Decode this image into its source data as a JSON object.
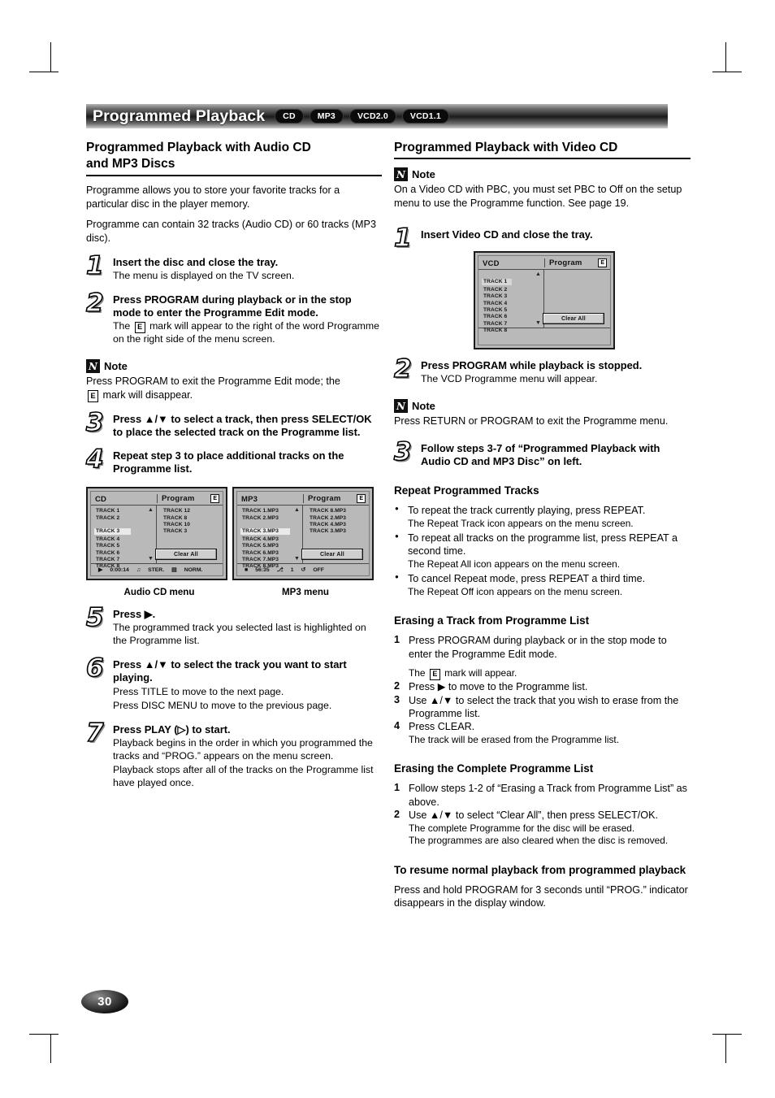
{
  "header": {
    "title": "Programmed Playback",
    "badges": [
      "CD",
      "MP3",
      "VCD2.0",
      "VCD1.1"
    ]
  },
  "page_number": "30",
  "left_column": {
    "section_title_line1": "Programmed Playback with Audio CD",
    "section_title_line2": "and MP3 Discs",
    "intro_1": "Programme allows you to store your favorite tracks for a particular disc in the player memory.",
    "intro_2": "Programme can contain 32 tracks (Audio CD) or 60 tracks (MP3 disc).",
    "step1": {
      "num": "1",
      "head": "Insert the disc and close the tray.",
      "desc": "The menu is displayed on the TV screen."
    },
    "step2": {
      "num": "2",
      "head": "Press PROGRAM during playback or in the stop mode to enter the Programme Edit mode.",
      "desc_before": "The",
      "desc_after": "mark will appear to the right of the word Programme on the right side of the menu screen."
    },
    "note1": {
      "icon": "note-N-icon",
      "label": "Note",
      "text_before": "Press PROGRAM to exit the Programme Edit mode; the",
      "text_after": "mark will disappear."
    },
    "step3": {
      "num": "3",
      "head": "Press ▲/▼ to select a track, then press SELECT/OK to place the selected track on the Programme list."
    },
    "step4": {
      "num": "4",
      "head": "Repeat step 3 to place additional tracks on the Programme list."
    },
    "caption_cd": "Audio CD menu",
    "caption_mp3": "MP3 menu",
    "step5": {
      "num": "5",
      "head": "Press ▶.",
      "desc": "The programmed track you selected last is highlighted on the Programme list."
    },
    "step6": {
      "num": "6",
      "head": "Press ▲/▼ to select the track you want to start playing.",
      "desc1": "Press TITLE to move to the next page.",
      "desc2": "Press DISC MENU to move to the previous page."
    },
    "step7": {
      "num": "7",
      "head": "Press PLAY (▷) to start.",
      "desc1": "Playback begins in the order in which you programmed the tracks and “PROG.” appears on the menu screen.",
      "desc2": "Playback stops after all of the tracks on the Programme list have played once."
    }
  },
  "osd_cd": {
    "title_left": "CD",
    "title_right": "Program",
    "edit_mark": "E",
    "tracks": [
      "TRACK 1",
      "TRACK 2",
      "TRACK 3",
      "TRACK 4",
      "TRACK 5",
      "TRACK 6",
      "TRACK 7",
      "TRACK 8"
    ],
    "selected_index": 2,
    "program": [
      "TRACK 12",
      "TRACK 8",
      "TRACK 10",
      "TRACK 3"
    ],
    "clear_all": "Clear All",
    "status": {
      "play_icon": "▶",
      "time": "0:00:14",
      "audio_icon": "audio-mode-icon",
      "audio": "STER.",
      "picture_icon": "picture-mode-icon",
      "picture": "NORM."
    }
  },
  "osd_mp3": {
    "title_left": "MP3",
    "title_right": "Program",
    "edit_mark": "E",
    "tracks": [
      "TRACK 1.MP3",
      "TRACK 2.MP3",
      "TRACK 3.MP3",
      "TRACK 4.MP3",
      "TRACK 5.MP3",
      "TRACK 6.MP3",
      "TRACK 7.MP3",
      "TRACK 8.MP3"
    ],
    "selected_index": 2,
    "program": [
      "TRACK 8.MP3",
      "TRACK 2.MP3",
      "TRACK 4.MP3",
      "TRACK 3.MP3"
    ],
    "clear_all": "Clear All",
    "status": {
      "stop_icon": "■",
      "time": "56:35",
      "marker_icon": "marker-icon",
      "marker": "1",
      "repeat_icon": "repeat-icon",
      "repeat": "OFF"
    }
  },
  "osd_vcd": {
    "title_left": "VCD",
    "title_right": "Program",
    "edit_mark": "E",
    "tracks": [
      "TRACK 1",
      "TRACK 2",
      "TRACK 3",
      "TRACK 4",
      "TRACK 5",
      "TRACK 6",
      "TRACK 7",
      "TRACK 8"
    ],
    "selected_index": 0,
    "program": [],
    "clear_all": "Clear All"
  },
  "right_column": {
    "section_title": "Programmed Playback with Video CD",
    "note1": {
      "icon": "note-N-icon",
      "label": "Note",
      "text": "On a Video CD with PBC, you must set PBC to Off on the setup menu to use the Programme function. See page 19."
    },
    "step1": {
      "num": "1",
      "head": "Insert Video CD and close the tray."
    },
    "step2": {
      "num": "2",
      "head": "Press PROGRAM while playback is stopped.",
      "desc": "The VCD Programme menu will appear."
    },
    "note2": {
      "icon": "note-N-icon",
      "label": "Note",
      "text": "Press RETURN or PROGRAM to exit the Programme menu."
    },
    "step3": {
      "num": "3",
      "head": "Follow steps 3-7 of “Programmed Playback with Audio CD and MP3 Disc” on left."
    },
    "repeat_heading": "Repeat Programmed Tracks",
    "repeat_bullets": [
      {
        "main": "To repeat the track currently playing, press REPEAT.",
        "sub": "The Repeat Track icon appears on the menu screen."
      },
      {
        "main": "To repeat all tracks on the programme list, press REPEAT a second time.",
        "sub": "The Repeat All icon appears on the menu screen."
      },
      {
        "main": "To cancel Repeat mode, press REPEAT a third time.",
        "sub": "The Repeat Off icon appears on the menu screen."
      }
    ],
    "erase_track_heading": "Erasing a Track from Programme List",
    "erase_track_steps": {
      "s1_num": "1",
      "s1_main": "Press PROGRAM during playback or in the stop mode to enter the Programme Edit mode.",
      "s1_sub_before": "The",
      "s1_sub_after": "mark will appear.",
      "s2_num": "2",
      "s2_main": "Press ▶ to move to the Programme list.",
      "s3_num": "3",
      "s3_main": "Use ▲/▼ to select the track that you wish to erase from the Programme list.",
      "s4_num": "4",
      "s4_main": "Press CLEAR.",
      "s4_sub": "The track will be erased from the Programme list."
    },
    "erase_all_heading": "Erasing the Complete Programme List",
    "erase_all_steps": {
      "s1_num": "1",
      "s1_main": "Follow steps 1-2 of “Erasing a Track from Programme List” as above.",
      "s2_num": "2",
      "s2_main": "Use ▲/▼ to select “Clear All”, then press SELECT/OK.",
      "s2_sub1": "The complete Programme for the disc will be erased.",
      "s2_sub2": "The programmes are also cleared when the disc is removed."
    },
    "resume_heading": "To resume normal playback from programmed playback",
    "resume_text": "Press and hold PROGRAM for 3 seconds until “PROG.” indicator disappears in the display window."
  }
}
